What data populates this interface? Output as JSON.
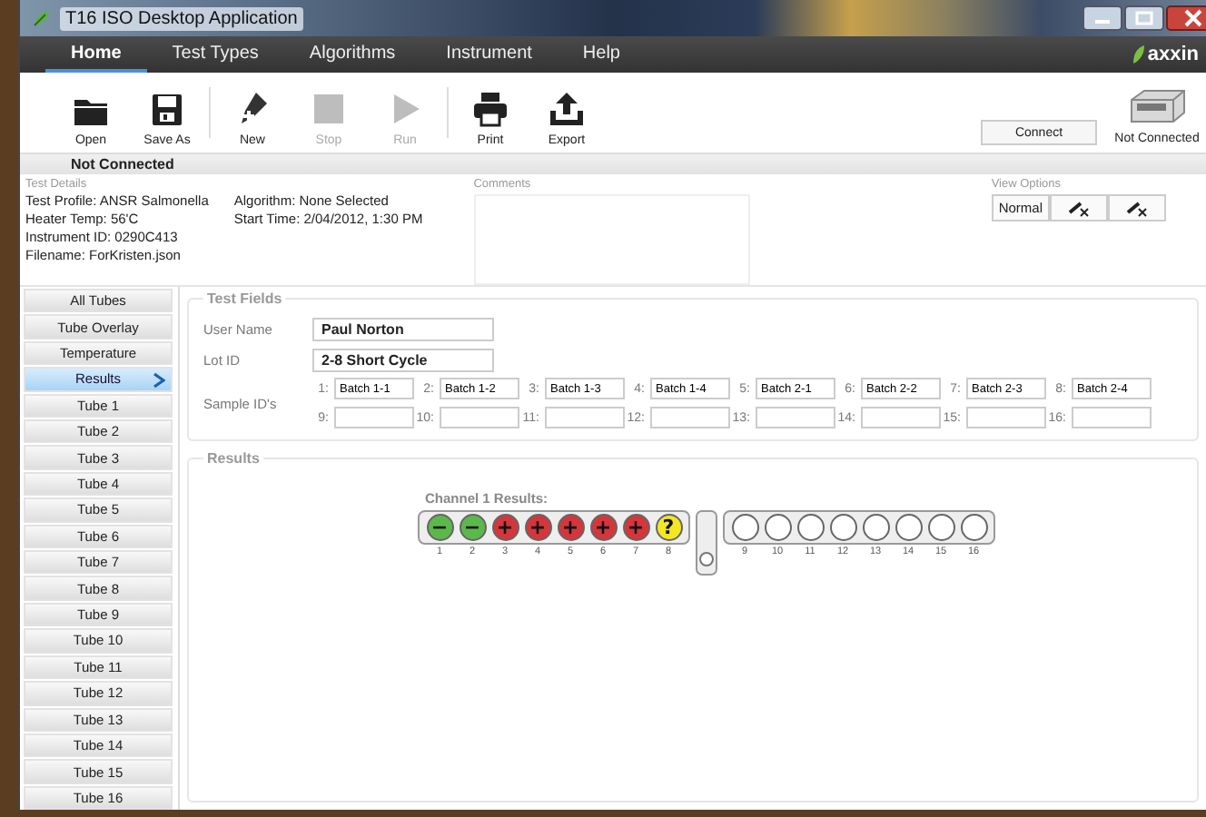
{
  "window": {
    "title": "T16 ISO Desktop Application"
  },
  "menu": [
    {
      "label": "Home",
      "selected": true
    },
    {
      "label": "Test Types",
      "selected": false
    },
    {
      "label": "Algorithms",
      "selected": false
    },
    {
      "label": "Instrument",
      "selected": false
    },
    {
      "label": "Help",
      "selected": false
    }
  ],
  "logo": {
    "text": "axxin"
  },
  "toolbar": [
    {
      "label": "Open",
      "disabled": false
    },
    {
      "label": "Save As",
      "disabled": false
    },
    {
      "label": "New",
      "disabled": false
    },
    {
      "label": "Stop",
      "disabled": true
    },
    {
      "label": "Run",
      "disabled": true
    },
    {
      "label": "Print",
      "disabled": false
    },
    {
      "label": "Export",
      "disabled": false
    }
  ],
  "connect_button": "Connect",
  "device_status": "Not Connected",
  "status_bar": "Not Connected",
  "test_details": {
    "heading": "Test Details",
    "left": [
      "Test Profile: ANSR Salmonella",
      "Heater Temp: 56'C",
      "Instrument ID: 0290C413",
      "Filename: ForKristen.json"
    ],
    "right": [
      "Algorithm: None Selected",
      "Start Time: 2/04/2012, 1:30 PM"
    ]
  },
  "comments": {
    "heading": "Comments"
  },
  "view_options": {
    "heading": "View Options",
    "buttons": [
      {
        "kind": "text",
        "label": "Normal"
      },
      {
        "kind": "icon"
      },
      {
        "kind": "icon"
      }
    ]
  },
  "sidebar": {
    "items": [
      {
        "label": "All Tubes",
        "selected": false
      },
      {
        "label": "Tube Overlay",
        "selected": false
      },
      {
        "label": "Temperature",
        "selected": false
      },
      {
        "label": "Results",
        "selected": true
      },
      {
        "label": "Tube 1",
        "selected": false
      },
      {
        "label": "Tube 2",
        "selected": false
      },
      {
        "label": "Tube 3",
        "selected": false
      },
      {
        "label": "Tube 4",
        "selected": false
      },
      {
        "label": "Tube 5",
        "selected": false
      },
      {
        "label": "Tube 6",
        "selected": false
      },
      {
        "label": "Tube 7",
        "selected": false
      },
      {
        "label": "Tube 8",
        "selected": false
      },
      {
        "label": "Tube 9",
        "selected": false
      },
      {
        "label": "Tube 10",
        "selected": false
      },
      {
        "label": "Tube 11",
        "selected": false
      },
      {
        "label": "Tube 12",
        "selected": false
      },
      {
        "label": "Tube 13",
        "selected": false
      },
      {
        "label": "Tube 14",
        "selected": false
      },
      {
        "label": "Tube 15",
        "selected": false
      },
      {
        "label": "Tube 16",
        "selected": false
      }
    ]
  },
  "test_fields": {
    "heading": "Test Fields",
    "user_name": {
      "label": "User Name",
      "value": "Paul Norton"
    },
    "lot_id": {
      "label": "Lot ID",
      "value": "2-8 Short Cycle"
    },
    "sample_ids": {
      "label": "Sample ID's",
      "slots": [
        {
          "number": "1:",
          "value": "Batch 1-1"
        },
        {
          "number": "2:",
          "value": "Batch 1-2"
        },
        {
          "number": "3:",
          "value": "Batch 1-3"
        },
        {
          "number": "4:",
          "value": "Batch 1-4"
        },
        {
          "number": "5:",
          "value": "Batch 2-1"
        },
        {
          "number": "6:",
          "value": "Batch 2-2"
        },
        {
          "number": "7:",
          "value": "Batch 2-3"
        },
        {
          "number": "8:",
          "value": "Batch 2-4"
        },
        {
          "number": "9:"
        },
        {
          "number": "10:"
        },
        {
          "number": "11:"
        },
        {
          "number": "12:"
        },
        {
          "number": "13:"
        },
        {
          "number": "14:"
        },
        {
          "number": "15:"
        },
        {
          "number": "16:"
        }
      ]
    }
  },
  "results": {
    "heading": "Results",
    "channel_title": "Channel 1 Results:",
    "tubes": [
      {
        "number": "1",
        "kind": "negative",
        "symbol": "−"
      },
      {
        "number": "2",
        "kind": "negative",
        "symbol": "−"
      },
      {
        "number": "3",
        "kind": "positive",
        "symbol": "+"
      },
      {
        "number": "4",
        "kind": "positive",
        "symbol": "+"
      },
      {
        "number": "5",
        "kind": "positive",
        "symbol": "+"
      },
      {
        "number": "6",
        "kind": "positive",
        "symbol": "+"
      },
      {
        "number": "7",
        "kind": "positive",
        "symbol": "+"
      },
      {
        "number": "8",
        "kind": "unknown",
        "symbol": "?"
      },
      {
        "number": "9",
        "kind": "empty"
      },
      {
        "number": "10",
        "kind": "empty"
      },
      {
        "number": "11",
        "kind": "empty"
      },
      {
        "number": "12",
        "kind": "empty"
      },
      {
        "number": "13",
        "kind": "empty"
      },
      {
        "number": "14",
        "kind": "empty"
      },
      {
        "number": "15",
        "kind": "empty"
      },
      {
        "number": "16",
        "kind": "empty"
      }
    ]
  }
}
